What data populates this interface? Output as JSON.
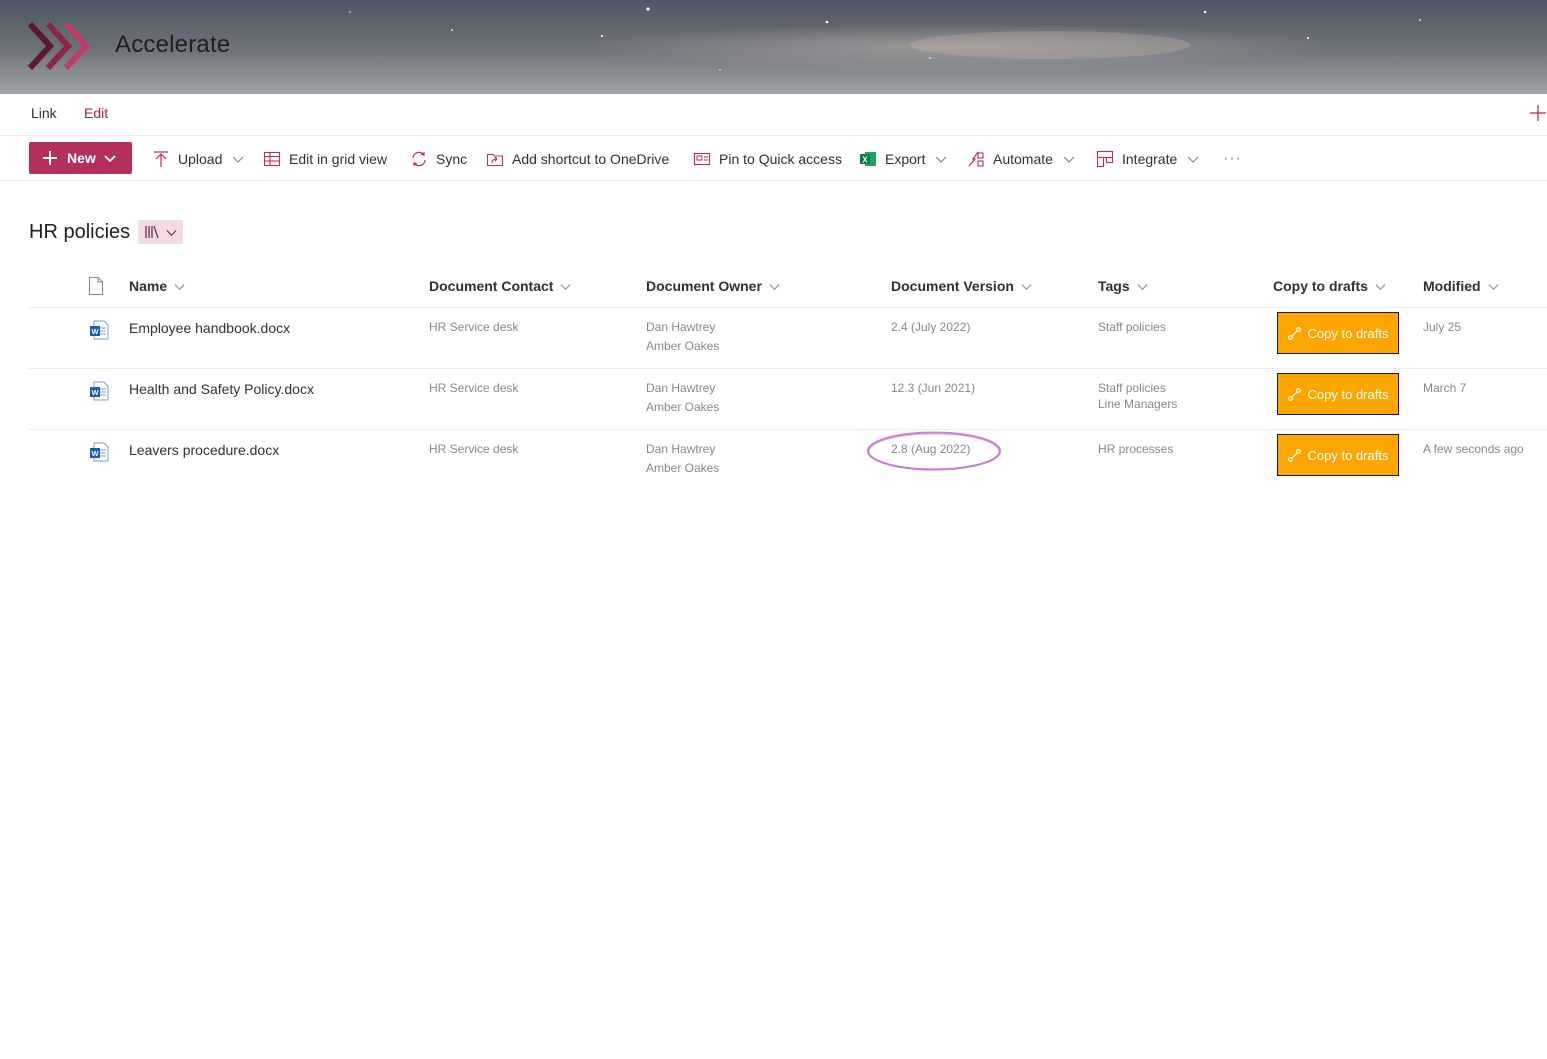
{
  "site": {
    "title": "Accelerate"
  },
  "topnav": {
    "items": [
      "Link",
      "Edit"
    ]
  },
  "commandbar": {
    "new_label": "New",
    "items": [
      {
        "label": "Upload",
        "icon": "upload-icon"
      },
      {
        "label": "Edit in grid view",
        "icon": "grid-icon"
      },
      {
        "label": "Sync",
        "icon": "sync-icon"
      },
      {
        "label": "Add shortcut to OneDrive",
        "icon": "shortcut-icon"
      },
      {
        "label": "Pin to Quick access",
        "icon": "pin-icon"
      },
      {
        "label": "Export",
        "icon": "excel-icon"
      },
      {
        "label": "Automate",
        "icon": "automate-icon"
      },
      {
        "label": "Integrate",
        "icon": "integrate-icon"
      }
    ],
    "more": "···"
  },
  "library": {
    "title": "HR policies"
  },
  "table": {
    "columns": [
      "Name",
      "Document Contact",
      "Document Owner",
      "Document Version",
      "Tags",
      "Copy to drafts",
      "Modified"
    ],
    "rows": [
      {
        "name": "Employee handbook.docx",
        "contact": "HR Service desk",
        "owners": [
          "Dan Hawtrey",
          "Amber Oakes"
        ],
        "version": "2.4 (July 2022)",
        "tags": [
          "Staff policies"
        ],
        "action": "Copy to drafts",
        "modified": "July 25"
      },
      {
        "name": "Health and Safety Policy.docx",
        "contact": "HR Service desk",
        "owners": [
          "Dan Hawtrey",
          "Amber Oakes"
        ],
        "version": "12.3 (Jun 2021)",
        "tags": [
          "Staff policies",
          "Line Managers"
        ],
        "action": "Copy to drafts",
        "modified": "March 7"
      },
      {
        "name": "Leavers procedure.docx",
        "contact": "HR Service desk",
        "owners": [
          "Dan Hawtrey",
          "Amber Oakes"
        ],
        "version": "2.8 (Aug 2022)",
        "tags": [
          "HR processes"
        ],
        "action": "Copy to drafts",
        "modified": "A few seconds ago"
      }
    ]
  },
  "colors": {
    "accent": "#b52f5c",
    "action": "#ffa500",
    "annotation": "#c06bc4"
  }
}
